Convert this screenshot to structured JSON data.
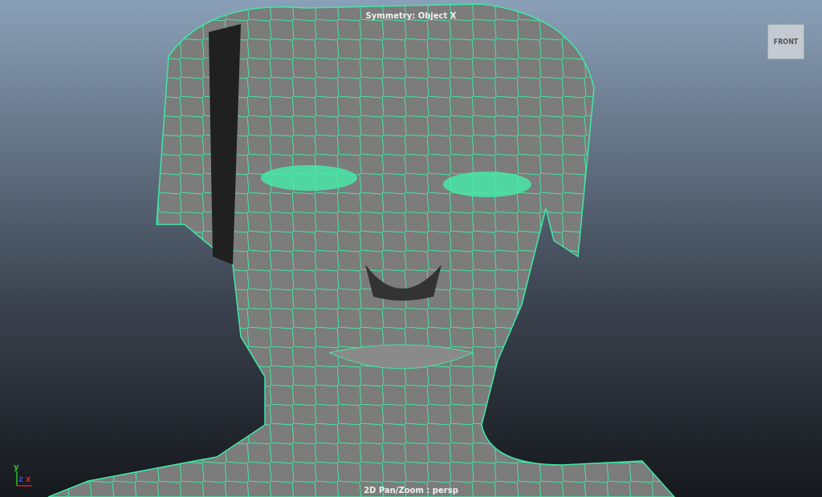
{
  "viewport": {
    "hud_title": "Symmetry: Object X",
    "camera_status": "2D Pan/Zoom : persp"
  },
  "view_cube": {
    "label": "FRONT"
  },
  "axis_indicator": {
    "y_label": "y",
    "z_label": "z",
    "x_label": "x"
  }
}
